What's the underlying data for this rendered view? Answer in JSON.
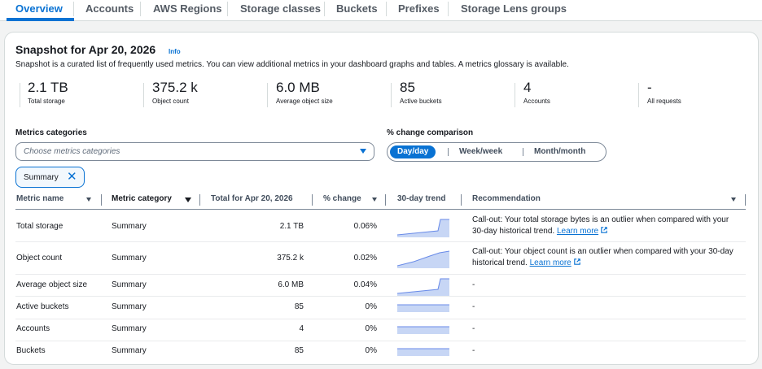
{
  "tabs": [
    {
      "label": "Overview",
      "active": true
    },
    {
      "label": "Accounts",
      "active": false
    },
    {
      "label": "AWS Regions",
      "active": false
    },
    {
      "label": "Storage classes",
      "active": false
    },
    {
      "label": "Buckets",
      "active": false
    },
    {
      "label": "Prefixes",
      "active": false
    },
    {
      "label": "Storage Lens groups",
      "active": false
    }
  ],
  "snapshot": {
    "title": "Snapshot for Apr 20, 2026",
    "info": "Info",
    "description": "Snapshot is a curated list of frequently used metrics. You can view additional metrics in your dashboard graphs and tables. A metrics glossary is available."
  },
  "kpis": [
    {
      "value": "2.1 TB",
      "label": "Total storage"
    },
    {
      "value": "375.2 k",
      "label": "Object count"
    },
    {
      "value": "6.0 MB",
      "label": "Average object size"
    },
    {
      "value": "85",
      "label": "Active buckets"
    },
    {
      "value": "4",
      "label": "Accounts"
    },
    {
      "value": "-",
      "label": "All requests"
    }
  ],
  "filters": {
    "categories_label": "Metrics categories",
    "categories_placeholder": "Choose metrics categories",
    "comparison_label": "% change comparison",
    "comparison_options": [
      "Day/day",
      "Week/week",
      "Month/month"
    ],
    "comparison_selected": "Day/day",
    "token_label": "Summary"
  },
  "table": {
    "headers": [
      "Metric name",
      "Metric category",
      "Total for Apr 20, 2026",
      "% change",
      "30-day trend",
      "Recommendation"
    ],
    "rows": [
      {
        "name": "Total storage",
        "category": "Summary",
        "total": "2.1 TB",
        "change": "0.06%",
        "trend": "step-up",
        "rec_text": "Call-out: Your total storage bytes is an outlier when compared with your 30-day historical trend.",
        "rec_link": "Learn more"
      },
      {
        "name": "Object count",
        "category": "Summary",
        "total": "375.2 k",
        "change": "0.02%",
        "trend": "rising",
        "rec_text": "Call-out: Your object count is an outlier when compared with your 30-day historical trend.",
        "rec_link": "Learn more"
      },
      {
        "name": "Average object size",
        "category": "Summary",
        "total": "6.0 MB",
        "change": "0.04%",
        "trend": "step-up-late",
        "rec_text": "-",
        "rec_link": ""
      },
      {
        "name": "Active buckets",
        "category": "Summary",
        "total": "85",
        "change": "0%",
        "trend": "flat",
        "rec_text": "-",
        "rec_link": ""
      },
      {
        "name": "Accounts",
        "category": "Summary",
        "total": "4",
        "change": "0%",
        "trend": "flat",
        "rec_text": "-",
        "rec_link": ""
      },
      {
        "name": "Buckets",
        "category": "Summary",
        "total": "85",
        "change": "0%",
        "trend": "flat",
        "rec_text": "-",
        "rec_link": ""
      }
    ]
  },
  "colors": {
    "accent": "#0972d3",
    "trend_fill": "#c7d6f5",
    "trend_line": "#688ae8"
  }
}
